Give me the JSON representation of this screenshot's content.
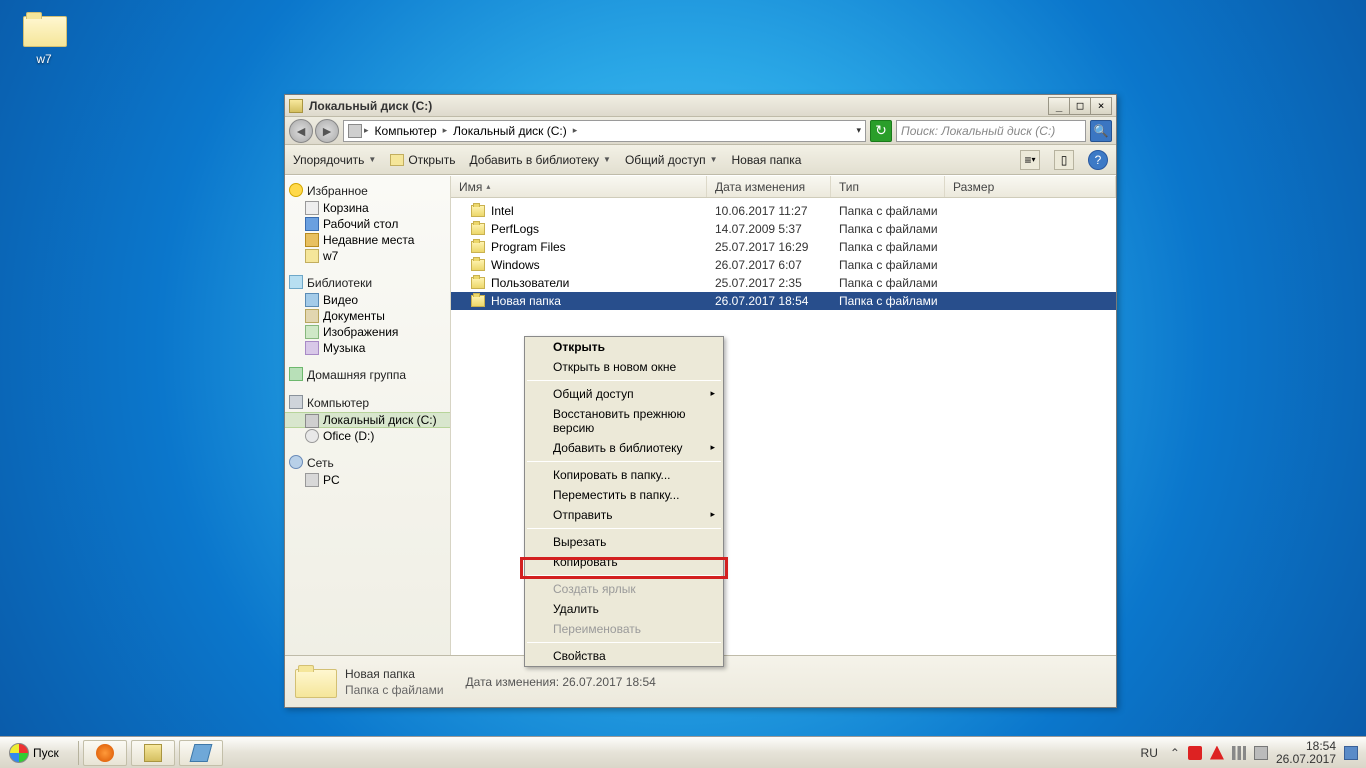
{
  "desktop": {
    "icon_label": "w7"
  },
  "window": {
    "title": "Локальный диск (C:)",
    "breadcrumb": {
      "computer": "Компьютер",
      "disk": "Локальный диск (C:)"
    },
    "search_placeholder": "Поиск: Локальный диск (C:)",
    "toolbar": {
      "arrange": "Упорядочить",
      "open": "Открыть",
      "add_lib": "Добавить в библиотеку",
      "share": "Общий доступ",
      "new_folder": "Новая папка"
    },
    "columns": {
      "name": "Имя",
      "date": "Дата изменения",
      "type": "Тип",
      "size": "Размер"
    },
    "files": [
      {
        "name": "Intel",
        "date": "10.06.2017 11:27",
        "type": "Папка с файлами"
      },
      {
        "name": "PerfLogs",
        "date": "14.07.2009 5:37",
        "type": "Папка с файлами"
      },
      {
        "name": "Program Files",
        "date": "25.07.2017 16:29",
        "type": "Папка с файлами"
      },
      {
        "name": "Windows",
        "date": "26.07.2017 6:07",
        "type": "Папка с файлами"
      },
      {
        "name": "Пользователи",
        "date": "25.07.2017 2:35",
        "type": "Папка с файлами"
      },
      {
        "name": "Новая папка",
        "date": "26.07.2017 18:54",
        "type": "Папка с файлами"
      }
    ],
    "details": {
      "name": "Новая папка",
      "type": "Папка с файлами",
      "meta_label": "Дата изменения:",
      "meta_value": "26.07.2017 18:54"
    }
  },
  "sidebar": {
    "favorites": "Избранное",
    "fav_items": {
      "recycle": "Корзина",
      "desktop": "Рабочий стол",
      "recent": "Недавние места",
      "w7": "w7"
    },
    "libraries": "Библиотеки",
    "lib_items": {
      "video": "Видео",
      "documents": "Документы",
      "images": "Изображения",
      "music": "Музыка"
    },
    "homegroup": "Домашняя группа",
    "computer": "Компьютер",
    "comp_items": {
      "c": "Локальный диск (C:)",
      "d": "Ofice (D:)"
    },
    "network": "Сеть",
    "net_items": {
      "pc": "PC"
    }
  },
  "context_menu": {
    "open": "Открыть",
    "open_new": "Открыть в новом окне",
    "share": "Общий доступ",
    "restore": "Восстановить прежнюю версию",
    "add_lib": "Добавить в библиотеку",
    "copy_to": "Копировать в папку...",
    "move_to": "Переместить в папку...",
    "send_to": "Отправить",
    "cut": "Вырезать",
    "copy": "Копировать",
    "shortcut": "Создать ярлык",
    "delete": "Удалить",
    "rename": "Переименовать",
    "properties": "Свойства"
  },
  "taskbar": {
    "start": "Пуск",
    "lang": "RU",
    "time": "18:54",
    "date": "26.07.2017"
  }
}
